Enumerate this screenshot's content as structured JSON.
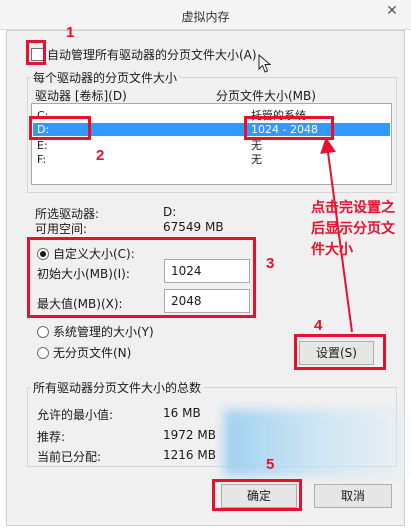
{
  "window": {
    "title": "虚拟内存",
    "close_glyph": "✕"
  },
  "auto_manage": {
    "label": "自动管理所有驱动器的分页文件大小(A)",
    "checked": false
  },
  "per_drive_group": {
    "title": "每个驱动器的分页文件大小",
    "col_drive": "驱动器 [卷标](D)",
    "col_size": "分页文件大小(MB)",
    "rows": [
      {
        "drive": "C:",
        "size": "托管的系统"
      },
      {
        "drive": "D:",
        "size": "1024 - 2048",
        "selected": true
      },
      {
        "drive": "E:",
        "size": "无"
      },
      {
        "drive": "F:",
        "size": "无"
      }
    ]
  },
  "selected_drive": {
    "label": "所选驱动器:",
    "value": "D:",
    "space_label": "可用空间:",
    "space_value": "67549 MB"
  },
  "custom_size": {
    "label": "自定义大小(C):",
    "selected": true,
    "initial_label": "初始大小(MB)(I):",
    "initial_value": "1024",
    "max_label": "最大值(MB)(X):",
    "max_value": "2048"
  },
  "system_managed": {
    "label": "系统管理的大小(Y)",
    "selected": false
  },
  "no_paging": {
    "label": "无分页文件(N)",
    "selected": false
  },
  "set_button": {
    "label": "设置(S)"
  },
  "total_group": {
    "title": "所有驱动器分页文件大小的总数",
    "min_label": "允许的最小值:",
    "min_value": "16 MB",
    "rec_label": "推荐:",
    "rec_value": "1972 MB",
    "cur_label": "当前已分配:",
    "cur_value": "1216 MB"
  },
  "ok_button": {
    "label": "确定"
  },
  "cancel_button": {
    "label": "取消"
  },
  "annotations": {
    "n1": "1",
    "n2": "2",
    "n3": "3",
    "n4": "4",
    "n5": "5",
    "note_line1": "点击完设置之",
    "note_line2": "后显示分页文",
    "note_line3": "件大小",
    "color": "#e8112d"
  }
}
